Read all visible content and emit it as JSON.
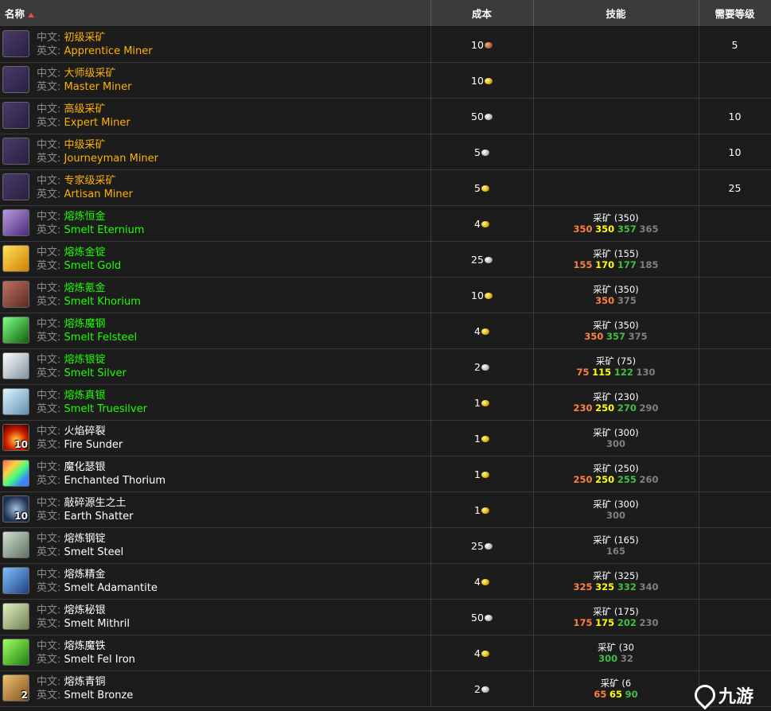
{
  "headers": {
    "name": "名称",
    "cost": "成本",
    "skill": "技能",
    "level": "需要等级"
  },
  "labels": {
    "cn": "中文:",
    "en": "英文:"
  },
  "rows": [
    {
      "cn": "初级采矿",
      "en": "Apprentice Miner",
      "quality": "orange",
      "icon": "pickaxe-icon",
      "count": "",
      "cost": "10",
      "coin": "copper",
      "skill_name": "",
      "s1": "",
      "s2": "",
      "s3": "",
      "s4": "",
      "level": "5"
    },
    {
      "cn": "大师级采矿",
      "en": "Master Miner",
      "quality": "orange",
      "icon": "pickaxe-icon",
      "count": "",
      "cost": "10",
      "coin": "gold",
      "skill_name": "",
      "s1": "",
      "s2": "",
      "s3": "",
      "s4": "",
      "level": ""
    },
    {
      "cn": "高级采矿",
      "en": "Expert Miner",
      "quality": "orange",
      "icon": "pickaxe-icon",
      "count": "",
      "cost": "50",
      "coin": "silver",
      "skill_name": "",
      "s1": "",
      "s2": "",
      "s3": "",
      "s4": "",
      "level": "10"
    },
    {
      "cn": "中级采矿",
      "en": "Journeyman Miner",
      "quality": "orange",
      "icon": "pickaxe-icon",
      "count": "",
      "cost": "5",
      "coin": "silver",
      "skill_name": "",
      "s1": "",
      "s2": "",
      "s3": "",
      "s4": "",
      "level": "10"
    },
    {
      "cn": "专家级采矿",
      "en": "Artisan Miner",
      "quality": "orange",
      "icon": "pickaxe-icon",
      "count": "",
      "cost": "5",
      "coin": "gold",
      "skill_name": "",
      "s1": "",
      "s2": "",
      "s3": "",
      "s4": "",
      "level": "25"
    },
    {
      "cn": "熔炼恒金",
      "en": "Smelt Eternium",
      "quality": "green",
      "icon": "eternium-bar-icon",
      "count": "",
      "cost": "4",
      "coin": "gold",
      "skill_name": "采矿 (350)",
      "s1": "350",
      "s2": "350",
      "s3": "357",
      "s4": "365",
      "level": ""
    },
    {
      "cn": "熔炼金锭",
      "en": "Smelt Gold",
      "quality": "green",
      "icon": "gold-bar-icon",
      "count": "",
      "cost": "25",
      "coin": "silver",
      "skill_name": "采矿 (155)",
      "s1": "155",
      "s2": "170",
      "s3": "177",
      "s4": "185",
      "level": ""
    },
    {
      "cn": "熔炼氪金",
      "en": "Smelt Khorium",
      "quality": "green",
      "icon": "khorium-bar-icon",
      "count": "",
      "cost": "10",
      "coin": "gold",
      "skill_name": "采矿 (350)",
      "s1": "350",
      "s2": "",
      "s3": "",
      "s4": "375",
      "level": ""
    },
    {
      "cn": "熔炼魔钢",
      "en": "Smelt Felsteel",
      "quality": "green",
      "icon": "felsteel-bar-icon",
      "count": "",
      "cost": "4",
      "coin": "gold",
      "skill_name": "采矿 (350)",
      "s1": "350",
      "s2": "",
      "s3": "357",
      "s4": "375",
      "level": ""
    },
    {
      "cn": "熔炼银锭",
      "en": "Smelt Silver",
      "quality": "green",
      "icon": "silver-bar-icon",
      "count": "",
      "cost": "2",
      "coin": "silver",
      "skill_name": "采矿 (75)",
      "s1": "75",
      "s2": "115",
      "s3": "122",
      "s4": "130",
      "level": ""
    },
    {
      "cn": "熔炼真银",
      "en": "Smelt Truesilver",
      "quality": "green",
      "icon": "truesilver-bar-icon",
      "count": "",
      "cost": "1",
      "coin": "gold",
      "skill_name": "采矿 (230)",
      "s1": "230",
      "s2": "250",
      "s3": "270",
      "s4": "290",
      "level": ""
    },
    {
      "cn": "火焰碎裂",
      "en": "Fire Sunder",
      "quality": "white",
      "icon": "fire-icon",
      "count": "10",
      "cost": "1",
      "coin": "gold",
      "skill_name": "采矿 (300)",
      "s1": "",
      "s2": "",
      "s3": "",
      "s4": "300",
      "level": ""
    },
    {
      "cn": "魔化瑟银",
      "en": "Enchanted Thorium",
      "quality": "white",
      "icon": "enchanted-thorium-bar-icon",
      "count": "",
      "cost": "1",
      "coin": "gold",
      "skill_name": "采矿 (250)",
      "s1": "250",
      "s2": "250",
      "s3": "255",
      "s4": "260",
      "level": ""
    },
    {
      "cn": "敲碎源生之土",
      "en": "Earth Shatter",
      "quality": "white",
      "icon": "earth-icon",
      "count": "10",
      "cost": "1",
      "coin": "gold",
      "skill_name": "采矿 (300)",
      "s1": "",
      "s2": "",
      "s3": "",
      "s4": "300",
      "level": ""
    },
    {
      "cn": "熔炼钢锭",
      "en": "Smelt Steel",
      "quality": "white",
      "icon": "steel-bar-icon",
      "count": "",
      "cost": "25",
      "coin": "silver",
      "skill_name": "采矿 (165)",
      "s1": "",
      "s2": "",
      "s3": "",
      "s4": "165",
      "level": ""
    },
    {
      "cn": "熔炼精金",
      "en": "Smelt Adamantite",
      "quality": "white",
      "icon": "adamantite-bar-icon",
      "count": "",
      "cost": "4",
      "coin": "gold",
      "skill_name": "采矿 (325)",
      "s1": "325",
      "s2": "325",
      "s3": "332",
      "s4": "340",
      "level": ""
    },
    {
      "cn": "熔炼秘银",
      "en": "Smelt Mithril",
      "quality": "white",
      "icon": "mithril-bar-icon",
      "count": "",
      "cost": "50",
      "coin": "silver",
      "skill_name": "采矿 (175)",
      "s1": "175",
      "s2": "175",
      "s3": "202",
      "s4": "230",
      "level": ""
    },
    {
      "cn": "熔炼魔铁",
      "en": "Smelt Fel Iron",
      "quality": "white",
      "icon": "fel-iron-bar-icon",
      "count": "",
      "cost": "4",
      "coin": "gold",
      "skill_name": "采矿 (30",
      "s1": "",
      "s2": "",
      "s3": "300",
      "s4": "32",
      "level": ""
    },
    {
      "cn": "熔炼青铜",
      "en": "Smelt Bronze",
      "quality": "white",
      "icon": "bronze-bar-icon",
      "count": "2",
      "cost": "2",
      "coin": "silver",
      "skill_name": "采矿 (6",
      "s1": "65",
      "s2": "65",
      "s3": "90",
      "s4": "",
      "level": ""
    }
  ],
  "watermark": {
    "text": "九游"
  },
  "colors": {
    "orange": "#ffb100",
    "green": "#1eff00",
    "white": "#ffffff"
  }
}
